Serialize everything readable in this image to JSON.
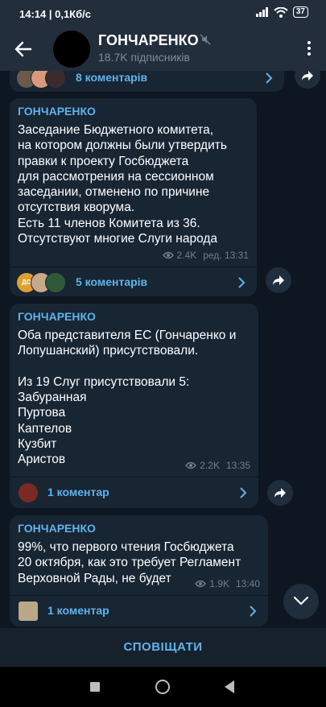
{
  "status": {
    "time_speed": "14:14 | 0,1Кб/с",
    "battery": "37"
  },
  "header": {
    "channel_name": "ГОНЧАРЕНКО",
    "subscribers": "18.7K підписників"
  },
  "posts": [
    {
      "comments_label": "8 коментарів"
    },
    {
      "author": "ГОНЧАРЕНКО",
      "text": "Заседание Бюджетного комитета,\nна котором должны были утвердить\nправки к проекту Госбюджета\nдля рассмотрения на сессионном\nзаседании, отменено по причине\nотсутствия кворума.\nЕсть 11 членов Комитета из 36.\nОтсутствуют многие Слуги народа",
      "views": "2.4K",
      "edited_time": "ред. 13:31",
      "comments_label": "5 коментарів",
      "avatar_text": "ДО"
    },
    {
      "author": "ГОНЧАРЕНКО",
      "text": "Оба представителя ЕС (Гончаренко и\nЛопушанский) присутствовали.\n\nИз 19 Слуг присутствовали 5:\nЗабуранная\nПуртова\nКаптелов\nКузбит\nАристов",
      "views": "2.2K",
      "time": "13:35",
      "comments_label": "1 коментар"
    },
    {
      "author": "ГОНЧАРЕНКО",
      "text": "99%, что первого чтения Госбюджета\n20 октября, как это требует Регламент\nВерховной Рады, не будет",
      "views": "1.9K",
      "time": "13:40",
      "comments_label": "1 коментар"
    }
  ],
  "footer": {
    "notify_label": "СПОВІЩАТИ"
  },
  "colors": {
    "background": "#0e1621",
    "bubble": "#182533",
    "accent": "#5fb3ec",
    "header": "#232e3c"
  }
}
